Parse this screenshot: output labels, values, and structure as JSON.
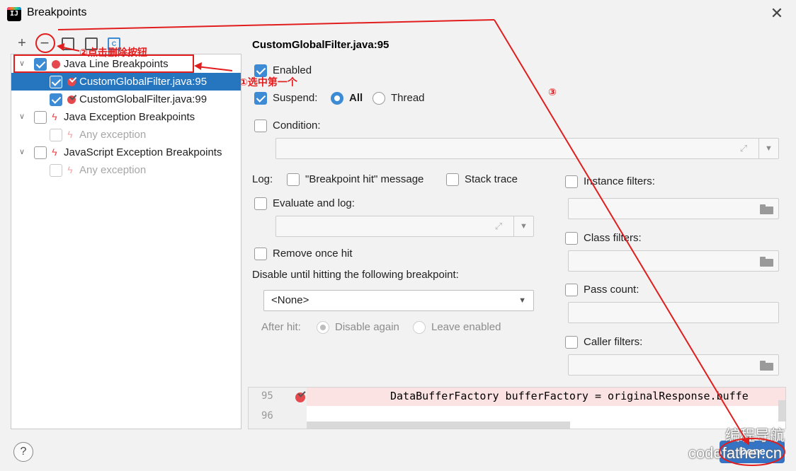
{
  "window": {
    "title": "Breakpoints",
    "close_glyph": "✕"
  },
  "toolbar": {
    "add": "+",
    "remove": "−",
    "icon4_letter": "C"
  },
  "tree": {
    "rows": [
      {
        "label": "Java Line Breakpoints"
      },
      {
        "label": "CustomGlobalFilter.java:95"
      },
      {
        "label": "CustomGlobalFilter.java:99"
      },
      {
        "label": "Java Exception Breakpoints"
      },
      {
        "label": "Any exception"
      },
      {
        "label": "JavaScript Exception Breakpoints"
      },
      {
        "label": "Any exception"
      }
    ]
  },
  "detail": {
    "title": "CustomGlobalFilter.java:95",
    "enabled": "Enabled",
    "suspend": "Suspend:",
    "suspend_all": "All",
    "suspend_thread": "Thread",
    "condition": "Condition:",
    "log": "Log:",
    "log_message": "\"Breakpoint hit\" message",
    "stack_trace": "Stack trace",
    "evaluate_log": "Evaluate and log:",
    "remove_once": "Remove once hit",
    "disable_until": "Disable until hitting the following breakpoint:",
    "disable_value": "<None>",
    "after_hit": "After hit:",
    "disable_again": "Disable again",
    "leave_enabled": "Leave enabled",
    "instance_filters": "Instance filters:",
    "class_filters": "Class filters:",
    "pass_count": "Pass count:",
    "caller_filters": "Caller filters:"
  },
  "code": {
    "line1_no": "95",
    "line2_no": "96",
    "line1_text": "DataBufferFactory bufferFactory = originalResponse.buffe"
  },
  "footer": {
    "help": "?",
    "done": "Done"
  },
  "annotations": {
    "step1": "①选中第一个",
    "step2": "②点击删除按钮",
    "step3": "③"
  },
  "watermark": {
    "line1": "编程导航",
    "line2": "codefather.cn"
  },
  "colors": {
    "accent": "#3d8bd4",
    "selection": "#2675bf",
    "breakpoint": "#e5494d",
    "annotation": "#e11d1d"
  }
}
